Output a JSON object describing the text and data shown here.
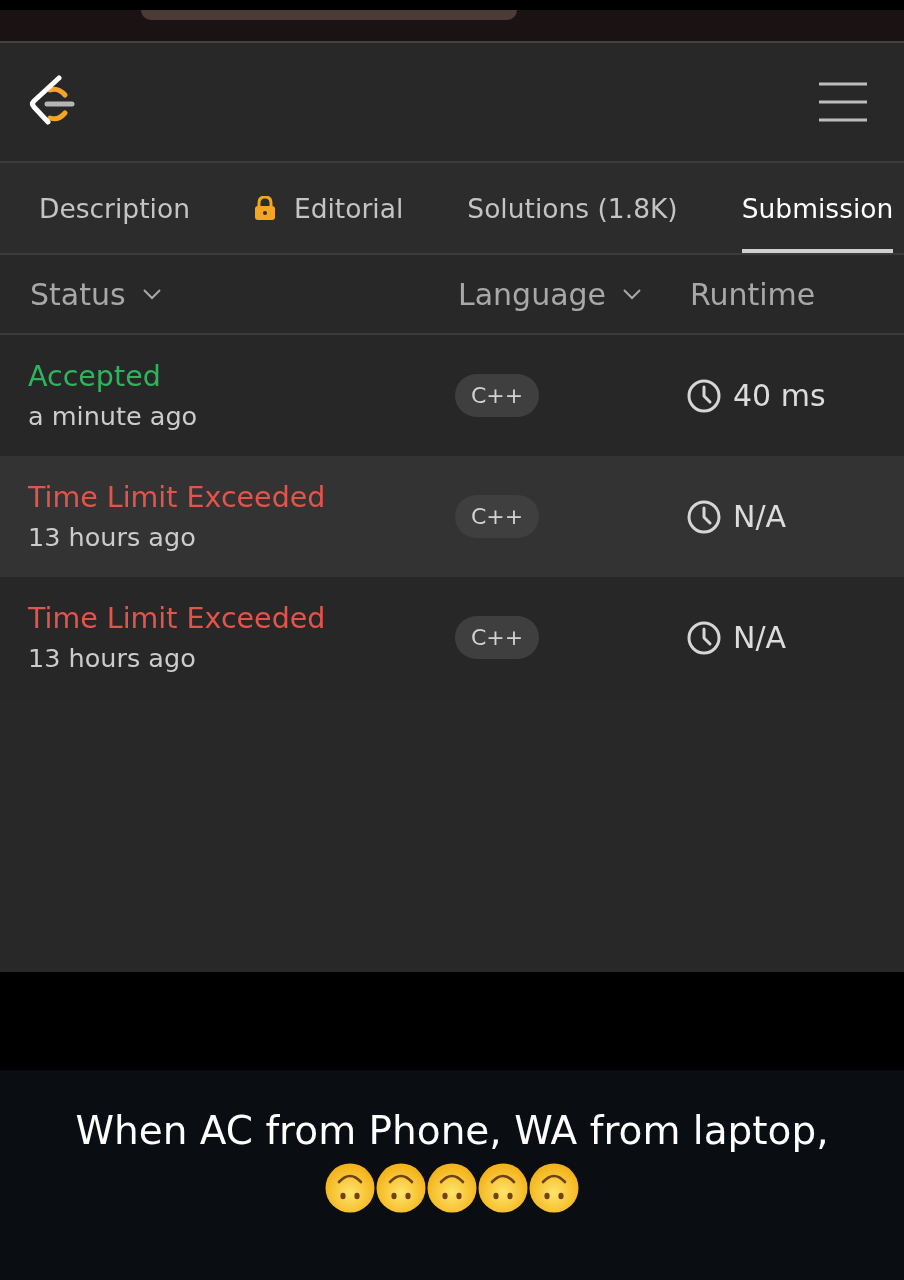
{
  "tabs": [
    {
      "label": "Description",
      "selected": false,
      "locked": false
    },
    {
      "label": "Editorial",
      "selected": false,
      "locked": true
    },
    {
      "label": "Solutions (1.8K)",
      "selected": false,
      "locked": false
    },
    {
      "label": "Submission",
      "selected": true,
      "locked": false
    }
  ],
  "table": {
    "columns": [
      {
        "label": "Status",
        "dropdown": true
      },
      {
        "label": "Language",
        "dropdown": true
      },
      {
        "label": "Runtime",
        "dropdown": false
      }
    ],
    "rows": [
      {
        "status": "Accepted",
        "color": "#2db55d",
        "time": "a minute ago",
        "language": "C++",
        "runtime": "40 ms"
      },
      {
        "status": "Time Limit Exceeded",
        "color": "#e5534b",
        "time": "13 hours ago",
        "language": "C++",
        "runtime": "N/A"
      },
      {
        "status": "Time Limit Exceeded",
        "color": "#e5534b",
        "time": "13 hours ago",
        "language": "C++",
        "runtime": "N/A"
      }
    ]
  },
  "caption": {
    "text": "When AC from Phone, WA from laptop,",
    "emojis": [
      {
        "kind": "upside-down-face"
      },
      {
        "kind": "upside-down-face"
      },
      {
        "kind": "upside-down-face"
      },
      {
        "kind": "upside-down-face"
      },
      {
        "kind": "upside-down-face"
      }
    ]
  }
}
